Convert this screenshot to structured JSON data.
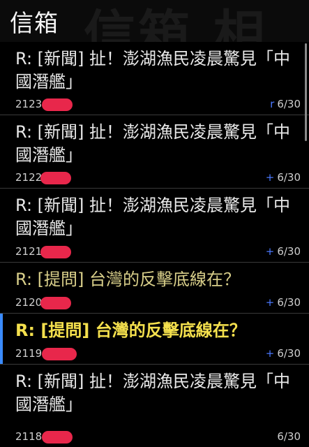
{
  "header": {
    "title": "信箱",
    "ghost_text": "信箱 相"
  },
  "messages": [
    {
      "subject": "R: [新聞] 扯！澎湖漁民凌晨驚見「中國潛艦」",
      "id": "2123",
      "mark": "r",
      "date": "6/30",
      "unread": false,
      "selected": false
    },
    {
      "subject": "R: [新聞] 扯！澎湖漁民凌晨驚見「中國潛艦」",
      "id": "2122",
      "mark": "+",
      "date": "6/30",
      "unread": false,
      "selected": false
    },
    {
      "subject": "R: [新聞] 扯！澎湖漁民凌晨驚見「中國潛艦」",
      "id": "2121",
      "mark": "+",
      "date": "6/30",
      "unread": false,
      "selected": false
    },
    {
      "subject": "R: [提問] 台灣的反擊底線在？",
      "id": "2120",
      "mark": "+",
      "date": "6/30",
      "unread": false,
      "selected": false
    },
    {
      "subject": "R: [提問] 台灣的反擊底線在？",
      "id": "2119",
      "mark": "+",
      "date": "6/30",
      "unread": true,
      "selected": true
    },
    {
      "subject": "R: [新聞] 扯！澎湖漁民凌晨驚見「中國潛艦」",
      "id": "2118",
      "mark": "",
      "date": "6/30",
      "unread": false,
      "selected": false
    }
  ],
  "colors": {
    "accent": "#3a8bff",
    "unread_text": "#f4e04d",
    "redaction": "#e8274b",
    "mark": "#4b79ff"
  }
}
